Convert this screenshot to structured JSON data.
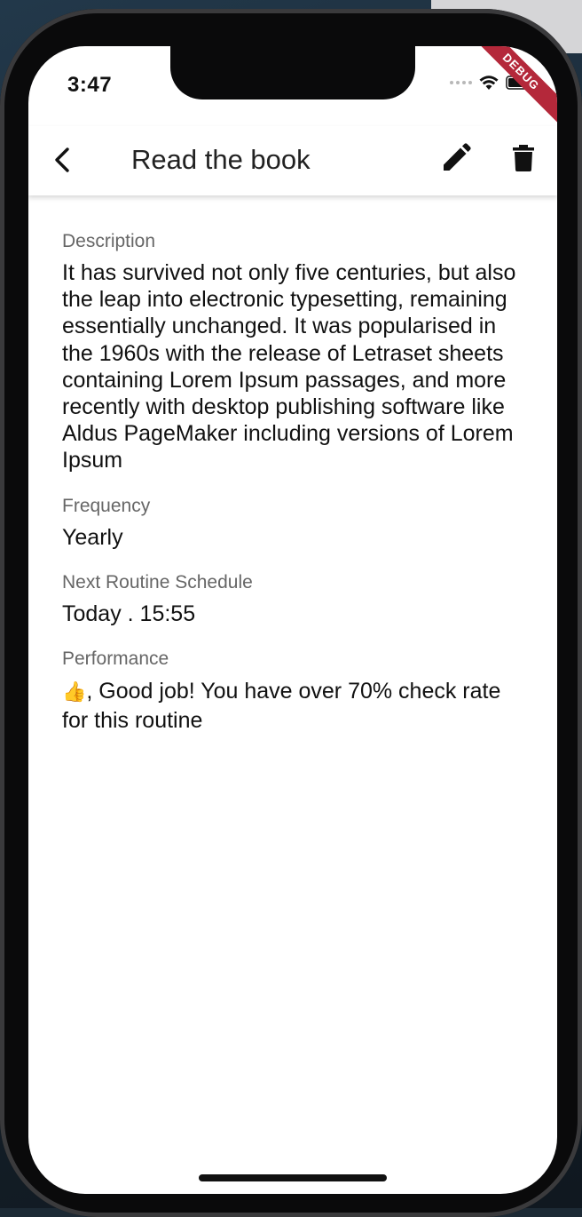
{
  "status_bar": {
    "time": "3:47",
    "debug_label": "DEBUG"
  },
  "app_bar": {
    "title": "Read the book"
  },
  "details": {
    "description_label": "Description",
    "description": "It has survived not only five centuries, but also the leap into electronic typesetting, remaining essentially unchanged. It was popularised in the 1960s with the release of Letraset sheets containing Lorem Ipsum passages, and more recently with desktop publishing software like Aldus PageMaker including versions of Lorem Ipsum",
    "frequency_label": "Frequency",
    "frequency": "Yearly",
    "schedule_label": "Next Routine Schedule",
    "schedule": "Today . 15:55",
    "performance_label": "Performance",
    "performance_emoji": "👍",
    "performance_text": ", Good job! You have over 70% check rate for this routine"
  },
  "icons": {
    "back": "chevron-left-icon",
    "edit": "pencil-icon",
    "delete": "trash-icon",
    "wifi": "wifi-icon",
    "battery": "battery-icon"
  },
  "colors": {
    "debug_ribbon": "#b4283a",
    "label_gray": "#666666",
    "text": "#111111"
  }
}
